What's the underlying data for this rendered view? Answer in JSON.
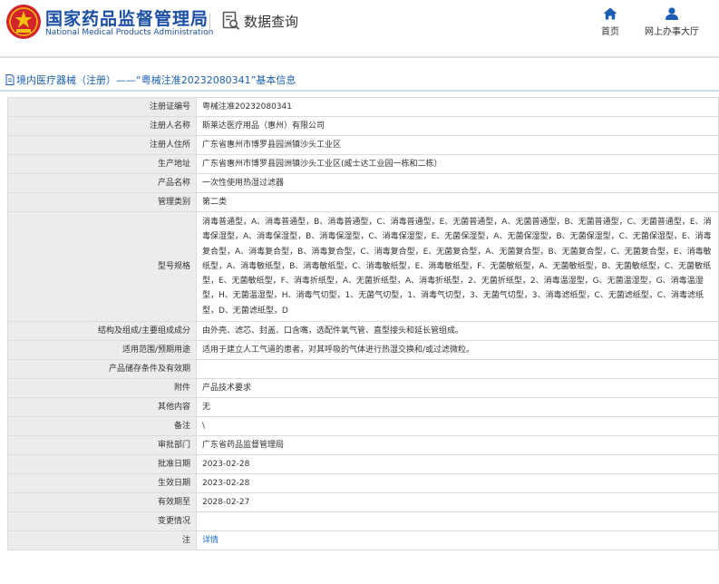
{
  "header": {
    "org_name_cn": "国家药品监督管理局",
    "org_name_en": "National Medical Products Administration",
    "query_title": "数据查询",
    "nav": [
      {
        "label": "首页",
        "icon": "home-icon"
      },
      {
        "label": "网上办事大厅",
        "icon": "user-icon"
      }
    ],
    "brand_color": "#1b4fa6"
  },
  "breadcrumb": "境内医疗器械（注册）——“粤械注准20232080341”基本信息",
  "record": [
    {
      "label": "注册证编号",
      "value": "粤械注准20232080341"
    },
    {
      "label": "注册人名称",
      "value": "斯莱达医疗用品（惠州）有限公司"
    },
    {
      "label": "注册人住所",
      "value": "广东省惠州市博罗县园洲镇沙头工业区"
    },
    {
      "label": "生产地址",
      "value": "广东省惠州市博罗县园洲镇沙头工业区(威士达工业园一栋和二栋）"
    },
    {
      "label": "产品名称",
      "value": "一次性使用热湿过滤器"
    },
    {
      "label": "管理类别",
      "value": "第二类"
    },
    {
      "label": "型号规格",
      "value": "消毒普通型，A、消毒普通型，B、消毒普通型，C、消毒普通型，E、无菌普通型，A、无菌普通型，B、无菌普通型，C、无菌普通型，E、消毒保湿型，A、消毒保湿型，B、消毒保湿型，C、消毒保湿型，E、无菌保湿型，A、无菌保湿型，B、无菌保湿型，C、无菌保湿型，E、消毒复合型，A、消毒复合型，B、消毒复合型，C、消毒复合型，E、无菌复合型，A、无菌复合型，B、无菌复合型，C、无菌复合型，E、消毒敏纸型，A、消毒敏纸型，B、消毒敏纸型，C、消毒敏纸型，E、消毒敏纸型，F、无菌敏纸型，A、无菌敏纸型，B、无菌敏纸型，C、无菌敏纸型，E、无菌敏纸型，F、消毒折纸型，A、无菌折纸型，A、消毒折纸型，2、无菌折纸型，2、消毒温湿型，G、无菌温湿型，G、消毒温湿型，H、无菌温湿型，H、消毒气切型，1、无菌气切型，1、消毒气切型，3、无菌气切型，3、消毒滤纸型，C、无菌滤纸型，C、消毒滤纸型，D、无菌滤纸型，D"
    },
    {
      "label": "结构及组成/主要组成成分",
      "value": "由外壳、滤芯、封盖、口含嘴，选配件氧气管、直型接头和延长管组成。"
    },
    {
      "label": "适用范围/预期用途",
      "value": "适用于建立人工气道的患者，对其呼吸的气体进行热湿交换和/或过滤微粒。"
    },
    {
      "label": "产品储存条件及有效期",
      "value": ""
    },
    {
      "label": "附件",
      "value": "产品技术要求"
    },
    {
      "label": "其他内容",
      "value": "无"
    },
    {
      "label": "备注",
      "value": "\\"
    },
    {
      "label": "审批部门",
      "value": "广东省药品监督管理局"
    },
    {
      "label": "批准日期",
      "value": "2023-02-28"
    },
    {
      "label": "生效日期",
      "value": "2023-02-28"
    },
    {
      "label": "有效期至",
      "value": "2028-02-27"
    },
    {
      "label": "变更情况",
      "value": ""
    },
    {
      "label": "注",
      "value": "详情"
    }
  ]
}
